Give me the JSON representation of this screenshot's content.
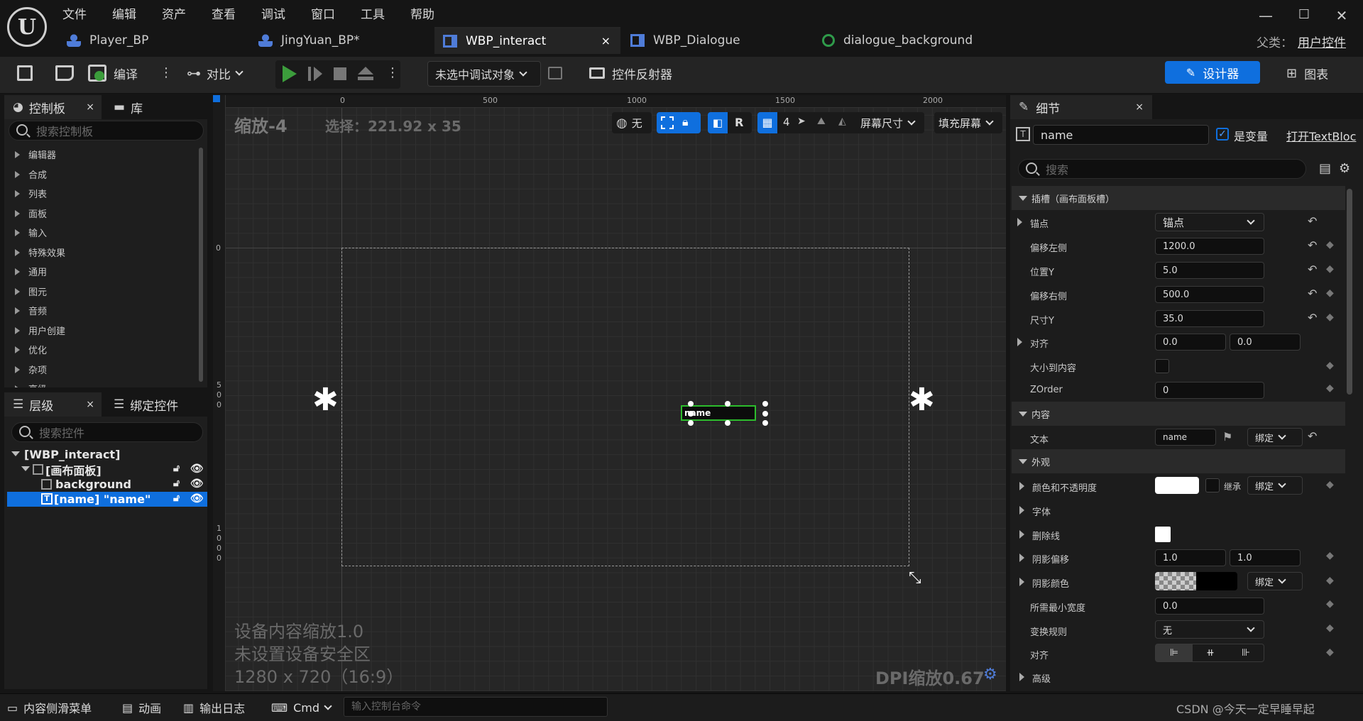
{
  "menu": [
    "文件",
    "编辑",
    "资产",
    "查看",
    "调试",
    "窗口",
    "工具",
    "帮助"
  ],
  "doc_tabs": [
    {
      "label": "Player_BP",
      "color": "#4f7cd8"
    },
    {
      "label": "JingYuan_BP*",
      "color": "#4f7cd8"
    },
    {
      "label": "WBP_interact",
      "color": "#4f7cd8",
      "close": "×"
    },
    {
      "label": "WBP_Dialogue",
      "color": "#4f7cd8"
    },
    {
      "label": "dialogue_background",
      "color": "#2f9b4a"
    }
  ],
  "parent_class": {
    "label": "父类：",
    "value": "用户控件"
  },
  "toolbar": {
    "compile": "编译",
    "diff": "对比",
    "debug_target": "未选中调试对象",
    "reflector": "控件反射器",
    "designer": "设计器",
    "graph": "图表"
  },
  "palette": {
    "tab": "控制板",
    "tab_close": "×",
    "library_tab": "库",
    "search_placeholder": "搜索控制板",
    "categories": [
      "编辑器",
      "合成",
      "列表",
      "面板",
      "输入",
      "特殊效果",
      "通用",
      "图元",
      "音频",
      "用户创建",
      "优化",
      "杂项",
      "高级"
    ]
  },
  "hierarchy": {
    "tab": "层级",
    "tab_close": "×",
    "bind_tab": "绑定控件",
    "search_placeholder": "搜索控件",
    "root": "[WBP_interact]",
    "canvas": "[画布面板]",
    "background": "background",
    "name_item": "[name] \"name\""
  },
  "canvas": {
    "zoom": "缩放-4",
    "selection": "选择：221.92 x 35",
    "toolbar": {
      "none": "无",
      "r": "R",
      "grid": "4",
      "screen_size": "屏幕尺寸",
      "fill_screen": "填充屏幕"
    },
    "ruler_top": [
      "0",
      "500",
      "1000",
      "1500",
      "2000"
    ],
    "ruler_left": [
      "0",
      "5\n0\n0",
      "1\n0\n0\n0"
    ],
    "widget_text": "name",
    "info": [
      "设备内容缩放1.0",
      "未设置设备安全区",
      "1280 x 720（16:9）"
    ],
    "dpi": "DPI缩放0.67"
  },
  "details": {
    "tab": "细节",
    "tab_close": "×",
    "name_value": "name",
    "is_variable": "是变量",
    "open_link": "打开TextBloc",
    "search_placeholder": "搜索",
    "slot_section": "插槽（画布面板槽）",
    "rows": {
      "anchor": "锚点",
      "anchor_value": "锚点",
      "offset_left": "偏移左侧",
      "offset_left_value": "1200.0",
      "pos_y": "位置Y",
      "pos_y_value": "5.0",
      "offset_right": "偏移右侧",
      "offset_right_value": "500.0",
      "size_y": "尺寸Y",
      "size_y_value": "35.0",
      "align": "对齐",
      "align_x": "0.0",
      "align_y": "0.0",
      "size_to_content": "大小到内容",
      "zorder": "ZOrder",
      "zorder_value": "0"
    },
    "content_section": "内容",
    "text_label": "文本",
    "text_value": "name",
    "bind": "绑定",
    "appearance_section": "外观",
    "app": {
      "color": "颜色和不透明度",
      "inherit": "继承",
      "bind": "绑定",
      "font": "字体",
      "strike": "删除线",
      "shadow_offset": "阴影偏移",
      "shadow_x": "1.0",
      "shadow_y": "1.0",
      "shadow_color": "阴影颜色",
      "shadow_bind": "绑定",
      "min_width": "所需最小宽度",
      "min_width_value": "0.0",
      "transform": "变换规则",
      "transform_value": "无",
      "justify": "对齐",
      "advanced": "高级"
    }
  },
  "bottom": {
    "drawer": "内容侧滑菜单",
    "anim": "动画",
    "log": "输出日志",
    "cmd": "Cmd",
    "cmd_placeholder": "输入控制台命令",
    "watermark": "CSDN @今天一定早睡早起"
  }
}
